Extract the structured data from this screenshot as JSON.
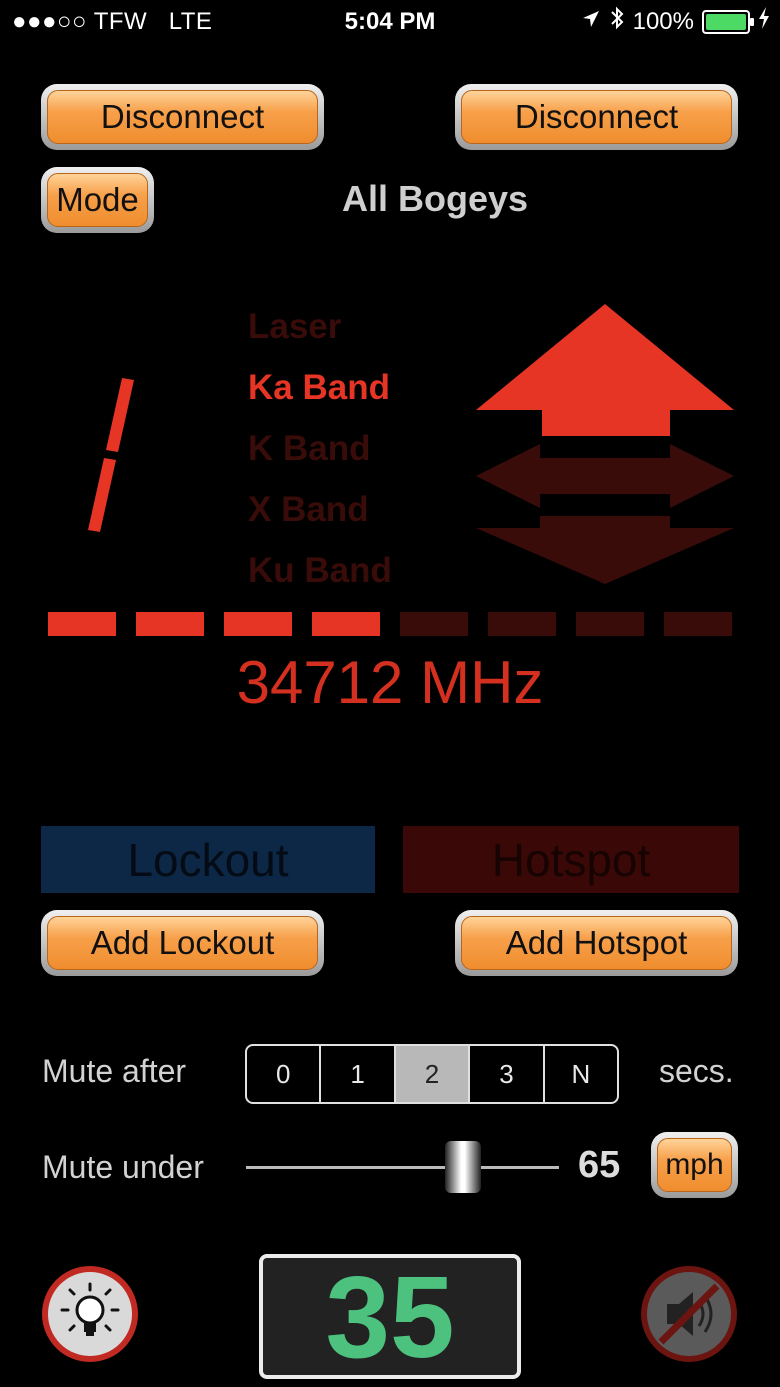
{
  "status_bar": {
    "carrier": "●●●○○ TFW",
    "network": "LTE",
    "time": "5:04 PM",
    "battery": "100%"
  },
  "buttons": {
    "disconnect_left": "Disconnect",
    "disconnect_right": "Disconnect",
    "mode": "Mode",
    "add_lockout": "Add Lockout",
    "add_hotspot": "Add Hotspot",
    "units": "mph"
  },
  "mode_title": "All Bogeys",
  "alert": {
    "count_digit": "/",
    "bands": [
      {
        "label": "Laser",
        "active": false
      },
      {
        "label": "Ka Band",
        "active": true
      },
      {
        "label": "K Band",
        "active": false
      },
      {
        "label": "X Band",
        "active": false
      },
      {
        "label": "Ku Band",
        "active": false
      }
    ],
    "arrows": {
      "front": true,
      "side": false,
      "rear": false
    },
    "signal_strength": {
      "lit": 4,
      "total": 8
    },
    "frequency": "34712 MHz"
  },
  "tags": {
    "lockout": "Lockout",
    "hotspot": "Hotspot"
  },
  "mute_after": {
    "label": "Mute after",
    "options": [
      "0",
      "1",
      "2",
      "3",
      "N"
    ],
    "selected": "2",
    "suffix": "secs."
  },
  "mute_under": {
    "label": "Mute under",
    "value": "65",
    "slider_fraction": 0.7
  },
  "current_speed": "35",
  "colors": {
    "active_red": "#e63524",
    "dim_red": "#3a0c09",
    "speed_green": "#4cc27e",
    "lockout_blue": "#0d2847",
    "hotspot_red": "#3a0907"
  },
  "icons": {
    "light": "light-bulb-icon",
    "mute": "speaker-muted-icon"
  }
}
